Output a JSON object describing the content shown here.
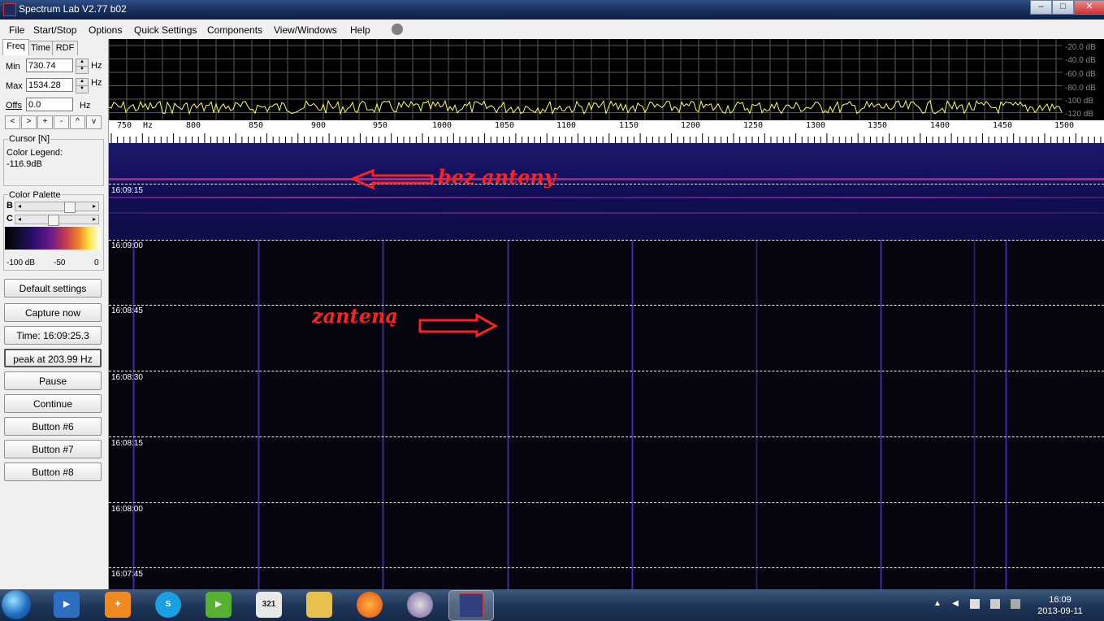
{
  "window": {
    "title": "Spectrum Lab V2.77 b02",
    "minimize": "–",
    "maximize": "□",
    "close": "✕"
  },
  "menu": [
    "File",
    "Start/Stop",
    "Options",
    "Quick Settings",
    "Components",
    "View/Windows",
    "Help"
  ],
  "tabs": [
    "Freq",
    "Time",
    "RDF"
  ],
  "freq": {
    "min_label": "Min",
    "min_value": "730.74",
    "max_label": "Max",
    "max_value": "1534.28",
    "offs_label": "Offs",
    "offs_value": "0.0",
    "unit": "Hz",
    "nav_buttons": [
      "<",
      ">",
      "+",
      "-",
      "^",
      "v"
    ]
  },
  "cursor": {
    "label": "Cursor [N]",
    "legend": "Color Legend:",
    "value": "-116.9dB"
  },
  "palette": {
    "label": "Color Palette",
    "b_label": "B",
    "c_label": "C",
    "min": "-100 dB",
    "mid": "-50",
    "max": "0"
  },
  "buttons": {
    "default_settings": "Default settings",
    "capture_now": "Capture now",
    "time": "Time:  16:09:25.3",
    "peak": "peak at 203.99 Hz",
    "pause": "Pause",
    "continue": "Continue",
    "b6": "Button #6",
    "b7": "Button #7",
    "b8": "Button #8"
  },
  "db_scale": [
    "-20.0 dB",
    "-40.0 dB",
    "-60.0 dB",
    "-80.0 dB",
    "-100 dB",
    "-120 dB"
  ],
  "freq_axis": {
    "unit": "Hz",
    "labels": [
      "750",
      "800",
      "850",
      "900",
      "950",
      "1000",
      "1050",
      "1100",
      "1150",
      "1200",
      "1250",
      "1300",
      "1350",
      "1400",
      "1450",
      "1500"
    ]
  },
  "time_markers": [
    "16:09:15",
    "16:09:00",
    "16:08:45",
    "16:08:30",
    "16:08:15",
    "16:08:00",
    "16:07:45"
  ],
  "annotations": {
    "without_antenna": "bez anteny",
    "with_antenna": "zanteną"
  },
  "colors": {
    "spectrum_trace": "#ffff60",
    "annotation": "#ff2020",
    "grid": "#ffffff"
  },
  "taskbar": {
    "icons": [
      "start-orb",
      "media-player",
      "avast",
      "skype",
      "green-app",
      "calendar-321",
      "file-explorer",
      "firefox",
      "eclipse-app",
      "spectrum-lab"
    ],
    "calendar_text": "321",
    "tray_arrow": "▲",
    "clock_time": "16:09",
    "clock_date": "2013-09-11"
  }
}
